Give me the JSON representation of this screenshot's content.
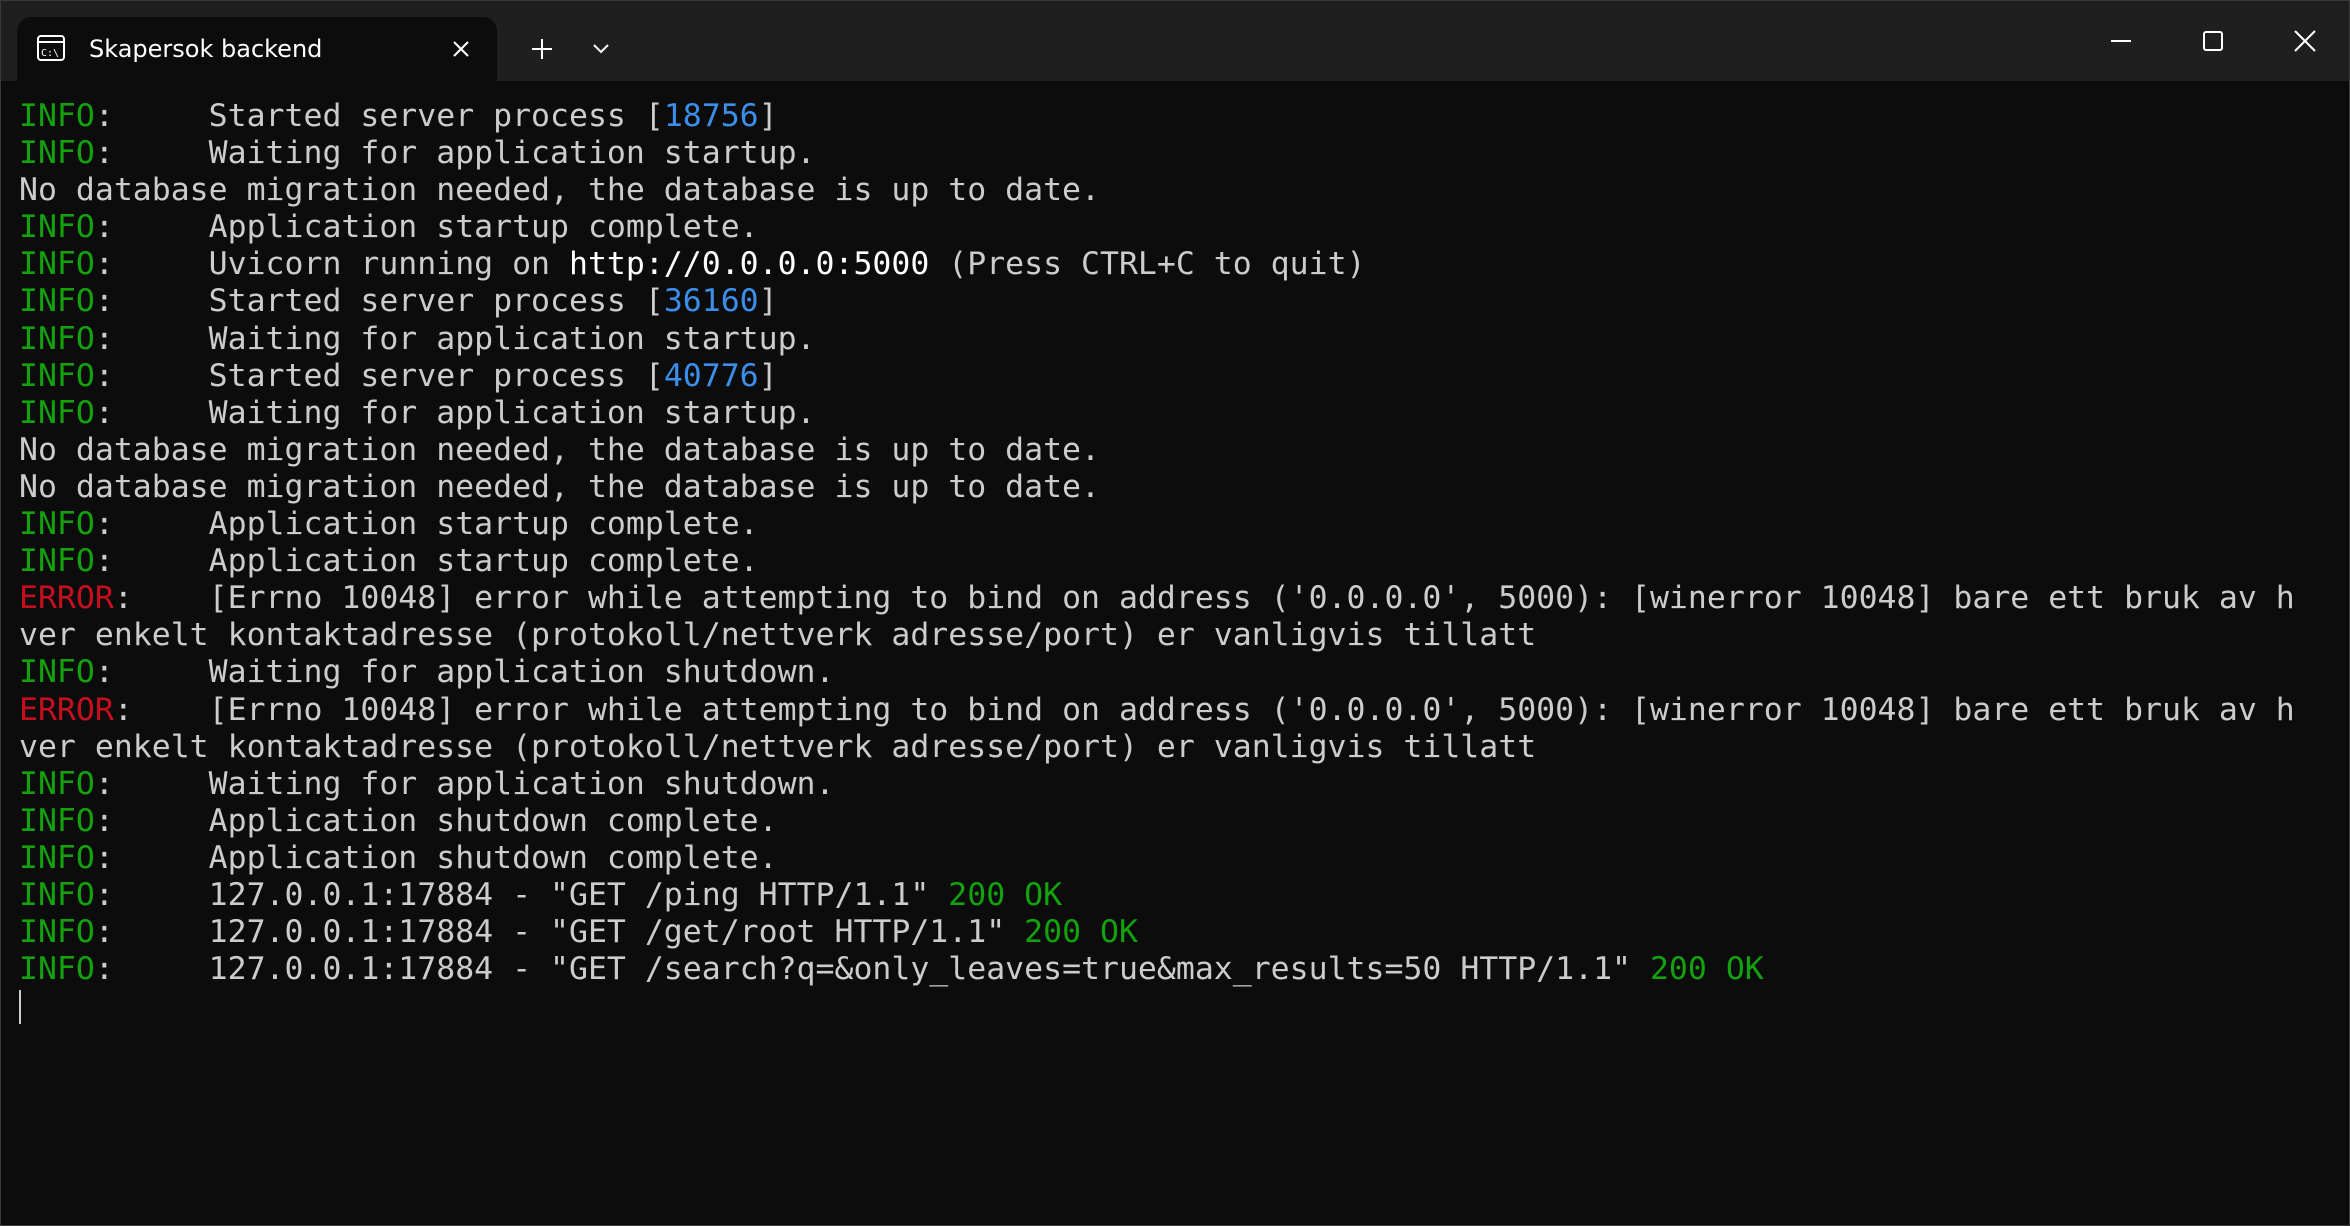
{
  "tab": {
    "title": "Skapersok backend",
    "icon": "terminal-icon"
  },
  "titlebar": {
    "new_tab_icon": "plus-icon",
    "dropdown_icon": "chevron-down-icon",
    "minimize_icon": "minimize-icon",
    "maximize_icon": "maximize-icon",
    "close_icon": "close-icon"
  },
  "colors": {
    "info": "#13a10e",
    "error": "#c50f1f",
    "pid": "#3b8eea",
    "text": "#cccccc",
    "background": "#0c0c0c"
  },
  "terminal": {
    "lines": [
      {
        "level": "INFO",
        "sep": ":     ",
        "text": "Started server process [",
        "pid": "18756",
        "tail": "]"
      },
      {
        "level": "INFO",
        "sep": ":     ",
        "text": "Waiting for application startup."
      },
      {
        "text": "No database migration needed, the database is up to date."
      },
      {
        "level": "INFO",
        "sep": ":     ",
        "text": "Application startup complete."
      },
      {
        "level": "INFO",
        "sep": ":     ",
        "text": "Uvicorn running on ",
        "url": "http://0.0.0.0:5000",
        "tail": " (Press CTRL+C to quit)"
      },
      {
        "level": "INFO",
        "sep": ":     ",
        "text": "Started server process [",
        "pid": "36160",
        "tail": "]"
      },
      {
        "level": "INFO",
        "sep": ":     ",
        "text": "Waiting for application startup."
      },
      {
        "level": "INFO",
        "sep": ":     ",
        "text": "Started server process [",
        "pid": "40776",
        "tail": "]"
      },
      {
        "level": "INFO",
        "sep": ":     ",
        "text": "Waiting for application startup."
      },
      {
        "text": "No database migration needed, the database is up to date."
      },
      {
        "text": "No database migration needed, the database is up to date."
      },
      {
        "level": "INFO",
        "sep": ":     ",
        "text": "Application startup complete."
      },
      {
        "level": "INFO",
        "sep": ":     ",
        "text": "Application startup complete."
      },
      {
        "level": "ERROR",
        "sep": ":    ",
        "text": "[Errno 10048] error while attempting to bind on address ('0.0.0.0', 5000): [winerror 10048] bare ett bruk av h"
      },
      {
        "text": "ver enkelt kontaktadresse (protokoll/nettverk adresse/port) er vanligvis tillatt"
      },
      {
        "level": "INFO",
        "sep": ":     ",
        "text": "Waiting for application shutdown."
      },
      {
        "level": "ERROR",
        "sep": ":    ",
        "text": "[Errno 10048] error while attempting to bind on address ('0.0.0.0', 5000): [winerror 10048] bare ett bruk av h"
      },
      {
        "text": "ver enkelt kontaktadresse (protokoll/nettverk adresse/port) er vanligvis tillatt"
      },
      {
        "level": "INFO",
        "sep": ":     ",
        "text": "Waiting for application shutdown."
      },
      {
        "level": "INFO",
        "sep": ":     ",
        "text": "Application shutdown complete."
      },
      {
        "level": "INFO",
        "sep": ":     ",
        "text": "Application shutdown complete."
      },
      {
        "level": "INFO",
        "sep": ":     ",
        "text": "127.0.0.1:17884 - \"GET /ping HTTP/1.1\" ",
        "status": "200 OK"
      },
      {
        "level": "INFO",
        "sep": ":     ",
        "text": "127.0.0.1:17884 - \"GET /get/root HTTP/1.1\" ",
        "status": "200 OK"
      },
      {
        "level": "INFO",
        "sep": ":     ",
        "text": "127.0.0.1:17884 - \"GET /search?q=&only_leaves=true&max_results=50 HTTP/1.1\" ",
        "status": "200 OK"
      }
    ]
  }
}
